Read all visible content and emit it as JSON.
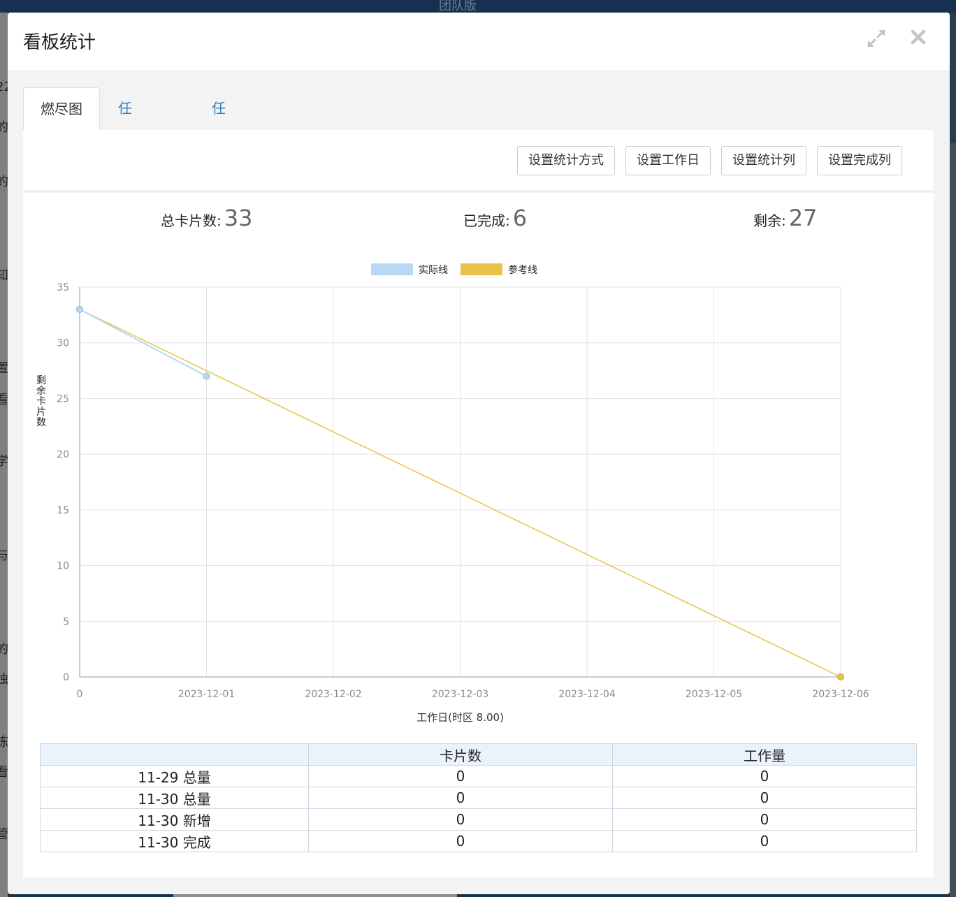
{
  "background": {
    "top_text": "团队版",
    "side_glyphs": [
      "22",
      "的",
      "的",
      "知",
      "置",
      "看",
      "学",
      "与",
      "的",
      "独",
      "栋",
      "看",
      "管"
    ]
  },
  "dialog": {
    "title": "看板统计",
    "expand_icon": "expand-icon",
    "close_icon": "close-icon"
  },
  "tabs": [
    {
      "label": "燃尽图",
      "active": true
    },
    {
      "label": "任务分布",
      "active": false
    },
    {
      "label": "任务周期",
      "active": false
    }
  ],
  "toolbar": {
    "stat_method_label": "设置统计方式",
    "workday_label": "设置工作日",
    "stat_columns_label": "设置统计列",
    "done_columns_label": "设置完成列"
  },
  "stats": {
    "total_label": "总卡片数:",
    "total_value": "33",
    "done_label": "已完成:",
    "done_value": "6",
    "remaining_label": "剩余:",
    "remaining_value": "27"
  },
  "chart_data": {
    "type": "line",
    "categories": [
      "0",
      "2023-12-01",
      "2023-12-02",
      "2023-12-03",
      "2023-12-04",
      "2023-12-05",
      "2023-12-06"
    ],
    "series": [
      {
        "name": "实际线",
        "color": "#b8d8f5",
        "values": [
          33,
          27,
          null,
          null,
          null,
          null,
          null
        ]
      },
      {
        "name": "参考线",
        "color": "#e9c24a",
        "values": [
          33,
          null,
          null,
          null,
          null,
          null,
          0
        ]
      }
    ],
    "xlabel": "工作日(时区 8.00)",
    "ylabel": "剩余卡片数",
    "ylim": [
      0,
      35
    ],
    "yticks": [
      "0",
      "5",
      "10",
      "15",
      "20",
      "25",
      "30",
      "35"
    ],
    "grid": true,
    "legend_position": "top-center"
  },
  "table": {
    "headers": [
      "",
      "卡片数",
      "工作量"
    ],
    "rows": [
      [
        "11-29 总量",
        "0",
        "0"
      ],
      [
        "11-30 总量",
        "0",
        "0"
      ],
      [
        "11-30 新增",
        "0",
        "0"
      ],
      [
        "11-30 完成",
        "0",
        "0"
      ]
    ]
  }
}
